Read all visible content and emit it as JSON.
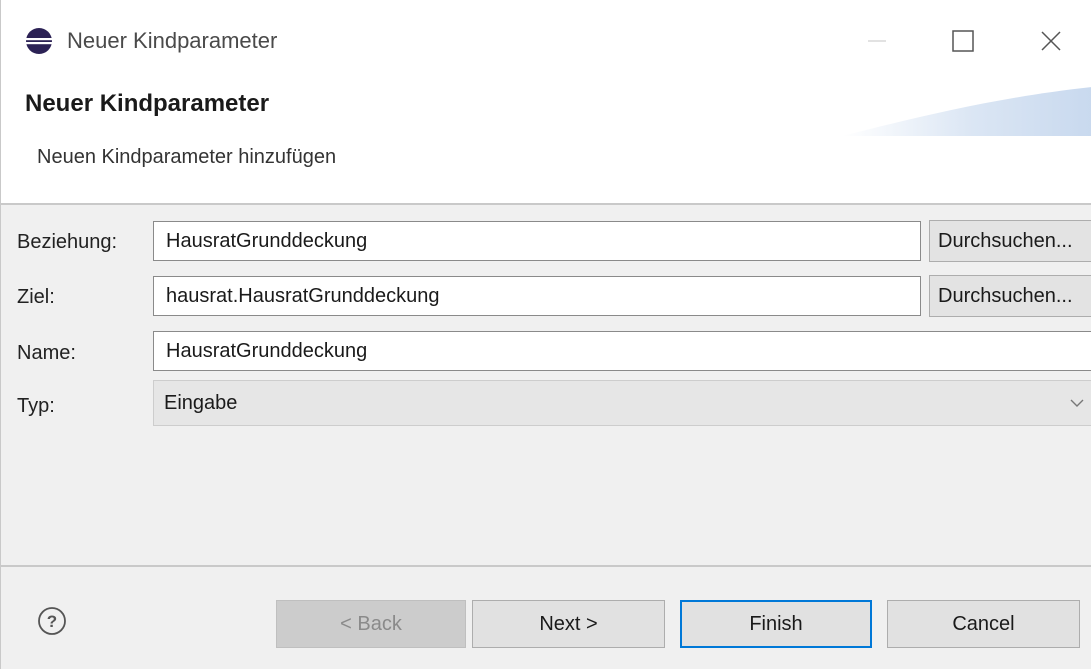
{
  "window": {
    "title": "Neuer Kindparameter",
    "controls": [
      "minimize-icon",
      "maximize-icon",
      "close-icon"
    ]
  },
  "header": {
    "title": "Neuer Kindparameter",
    "description": "Neuen Kindparameter hinzufügen"
  },
  "form": {
    "beziehung": {
      "label": "Beziehung:",
      "value": "HausratGrunddeckung",
      "browse_label": "Durchsuchen..."
    },
    "ziel": {
      "label": "Ziel:",
      "value": "hausrat.HausratGrunddeckung",
      "browse_label": "Durchsuchen..."
    },
    "name": {
      "label": "Name:",
      "value": "HausratGrunddeckung"
    },
    "typ": {
      "label": "Typ:",
      "selected": "Eingabe"
    }
  },
  "footer": {
    "back_label": "< Back",
    "next_label": "Next >",
    "finish_label": "Finish",
    "cancel_label": "Cancel"
  },
  "colors": {
    "accent": "#0078d7",
    "eclipse_purple": "#2c2255"
  }
}
